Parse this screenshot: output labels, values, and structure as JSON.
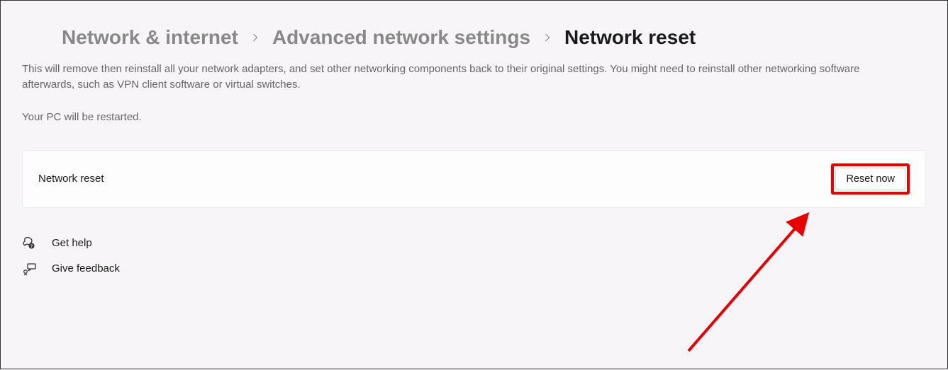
{
  "breadcrumb": {
    "level1": "Network & internet",
    "level2": "Advanced network settings",
    "current": "Network reset"
  },
  "page": {
    "description": "This will remove then reinstall all your network adapters, and set other networking components back to their original settings. You might need to reinstall other networking software afterwards, such as VPN client software or virtual switches.",
    "note": "Your PC will be restarted."
  },
  "card": {
    "label": "Network reset",
    "button": "Reset now"
  },
  "footer": {
    "help": "Get help",
    "feedback": "Give feedback"
  },
  "annotation": {
    "highlight_color": "#e60000"
  }
}
